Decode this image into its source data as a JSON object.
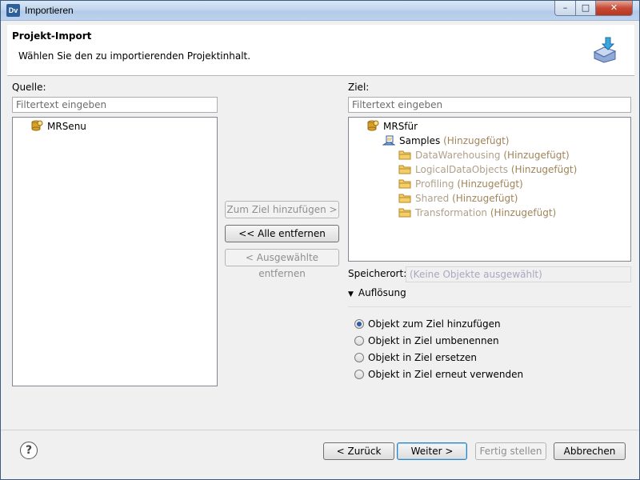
{
  "window": {
    "app_icon_text": "Dv",
    "title": "Importieren",
    "min_glyph": "–",
    "max_glyph": "□",
    "close_glyph": "✕"
  },
  "banner": {
    "title": "Projekt-Import",
    "subtitle": "Wählen Sie den zu importierenden Projektinhalt."
  },
  "source": {
    "label": "Quelle:",
    "filter_placeholder": "Filtertext eingeben",
    "items": [
      {
        "label": "MRSenu",
        "icon": "project-icon"
      }
    ]
  },
  "transfer_buttons": {
    "add": "Zum Ziel hinzufügen >",
    "remove_all": "<< Alle entfernen",
    "remove_selected": "< Ausgewählte entfernen"
  },
  "target": {
    "label": "Ziel:",
    "filter_placeholder": "Filtertext eingeben",
    "root": {
      "label": "MRSfür",
      "icon": "project-icon"
    },
    "folder": {
      "label": "Samples",
      "tag": "(Hinzugefügt)",
      "icon": "samples-icon"
    },
    "children": [
      {
        "label": "DataWarehousing",
        "tag": "(Hinzugefügt)",
        "icon": "folder-icon"
      },
      {
        "label": "LogicalDataObjects",
        "tag": "(Hinzugefügt)",
        "icon": "folder-icon"
      },
      {
        "label": "Profiling",
        "tag": "(Hinzugefügt)",
        "icon": "folder-icon"
      },
      {
        "label": "Shared",
        "tag": "(Hinzugefügt)",
        "icon": "folder-icon"
      },
      {
        "label": "Transformation",
        "tag": "(Hinzugefügt)",
        "icon": "folder-icon"
      }
    ]
  },
  "location": {
    "label": "Speicherort:",
    "value": "(Keine Objekte ausgewählt)"
  },
  "resolution": {
    "label": "Auflösung",
    "options": [
      {
        "label": "Objekt zum Ziel hinzufügen",
        "checked": true
      },
      {
        "label": "Objekt in Ziel umbenennen",
        "checked": false
      },
      {
        "label": "Objekt in Ziel ersetzen",
        "checked": false
      },
      {
        "label": "Objekt in Ziel erneut verwenden",
        "checked": false
      }
    ]
  },
  "footer": {
    "help": "?",
    "back": "< Zurück",
    "next": "Weiter >",
    "finish": "Fertig stellen",
    "cancel": "Abbrechen"
  },
  "colors": {
    "added_tag": "#a0845a",
    "muted_text": "#b0a08a",
    "folder": "#e8b84a",
    "project": "#d7a12a"
  }
}
